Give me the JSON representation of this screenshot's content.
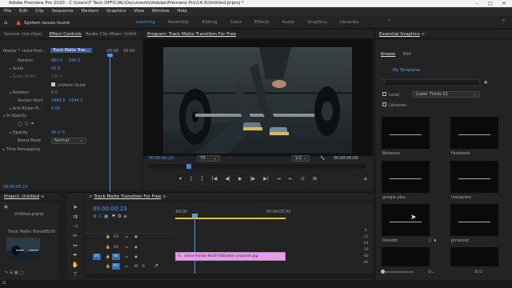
{
  "window": {
    "title": "Adobe Premiere Pro 2020 - C:\\Users\\T Tech OFFICIAL\\Documents\\Adobe\\Premiere Pro\\14.0\\Untitled.prproj *",
    "app_icon": "Pr",
    "controls": [
      "–",
      "□",
      "✕"
    ]
  },
  "menu": [
    "File",
    "Edit",
    "Clip",
    "Sequence",
    "Markers",
    "Graphics",
    "View",
    "Window",
    "Help"
  ],
  "warning": "System issues found",
  "workspaces": [
    "Learning",
    "Assembly",
    "Editing",
    "Color",
    "Effects",
    "Audio",
    "Graphics",
    "Libraries"
  ],
  "workspaces_active": "Learning",
  "effect_controls": {
    "tabs": [
      "Source: (no clips)",
      "Effect Controls",
      "Audio Clip Mixer: Untitl"
    ],
    "master": "Master * victor-freit...",
    "clip": "Track Matte Tran...",
    "ruler": [
      ":00:00",
      "00:00"
    ],
    "rows": [
      {
        "label": "Position",
        "v1": "960.0",
        "v2": "540.0"
      },
      {
        "label": "Scale",
        "v1": "42.0",
        "v2": ""
      },
      {
        "label": "Scale Width",
        "v1": "100.0",
        "v2": ""
      },
      {
        "label": "Uniform Scale",
        "v1": "",
        "v2": ""
      },
      {
        "label": "Rotation",
        "v1": "0.0",
        "v2": ""
      },
      {
        "label": "Anchor Point",
        "v1": "2464.5",
        "v2": "1644.5"
      },
      {
        "label": "Anti-flicker Fi...",
        "v1": "0.00",
        "v2": ""
      },
      {
        "label": "Opacity",
        "v1": "",
        "v2": ""
      },
      {
        "label": "Opacity",
        "v1": "90.0 %",
        "v2": ""
      },
      {
        "label": "Blend Mode",
        "v1": "Normal",
        "v2": ""
      },
      {
        "label": "Time Remapping",
        "v1": "",
        "v2": ""
      }
    ],
    "fx": "fx",
    "timecode": "00:00:00:23"
  },
  "program": {
    "tab": "Program: Track Matte Transition For Free",
    "timecode": "00:00:00:23",
    "fit": "Fit",
    "ratio": "1/2",
    "duration": "00:00:05:00",
    "transport": [
      "▾",
      "{",
      "}",
      "|◀",
      "◀|",
      "▶",
      "|▶",
      "▶|",
      "⇥",
      "⇤",
      "⊙",
      "⊞",
      "+"
    ]
  },
  "essential_graphics": {
    "tab": "Essential Graphics",
    "subtabs": [
      "Browse",
      "Edit"
    ],
    "my_templates": "My Templates",
    "local": "Local",
    "folder": "Lower Thirds 01",
    "libraries": "Libraries",
    "templates": [
      "Behance",
      "Facebook",
      "google plus",
      "instagram",
      "linkedin",
      "pinterest",
      "",
      ""
    ]
  },
  "project": {
    "tab": "Project: Untitled",
    "file": "Untitled.prproj",
    "item": "Track Matte Transiti...",
    "item_dur": "5:00"
  },
  "timeline": {
    "tab": "Track Matte Transition For Free",
    "timecode": "00:00:00:23",
    "ruler": [
      ":00:00",
      "00:00:05:00"
    ],
    "tracks": [
      "V3",
      "V2",
      "V1",
      "A1"
    ],
    "clip": "victor-freitas-WvDYdXDzkhs-unsplash.jpg"
  },
  "colors": {
    "accent": "#4d9cf0",
    "clip": "#e89cf0",
    "playhead": "#2f8ae8",
    "warning": "#e8453a"
  }
}
